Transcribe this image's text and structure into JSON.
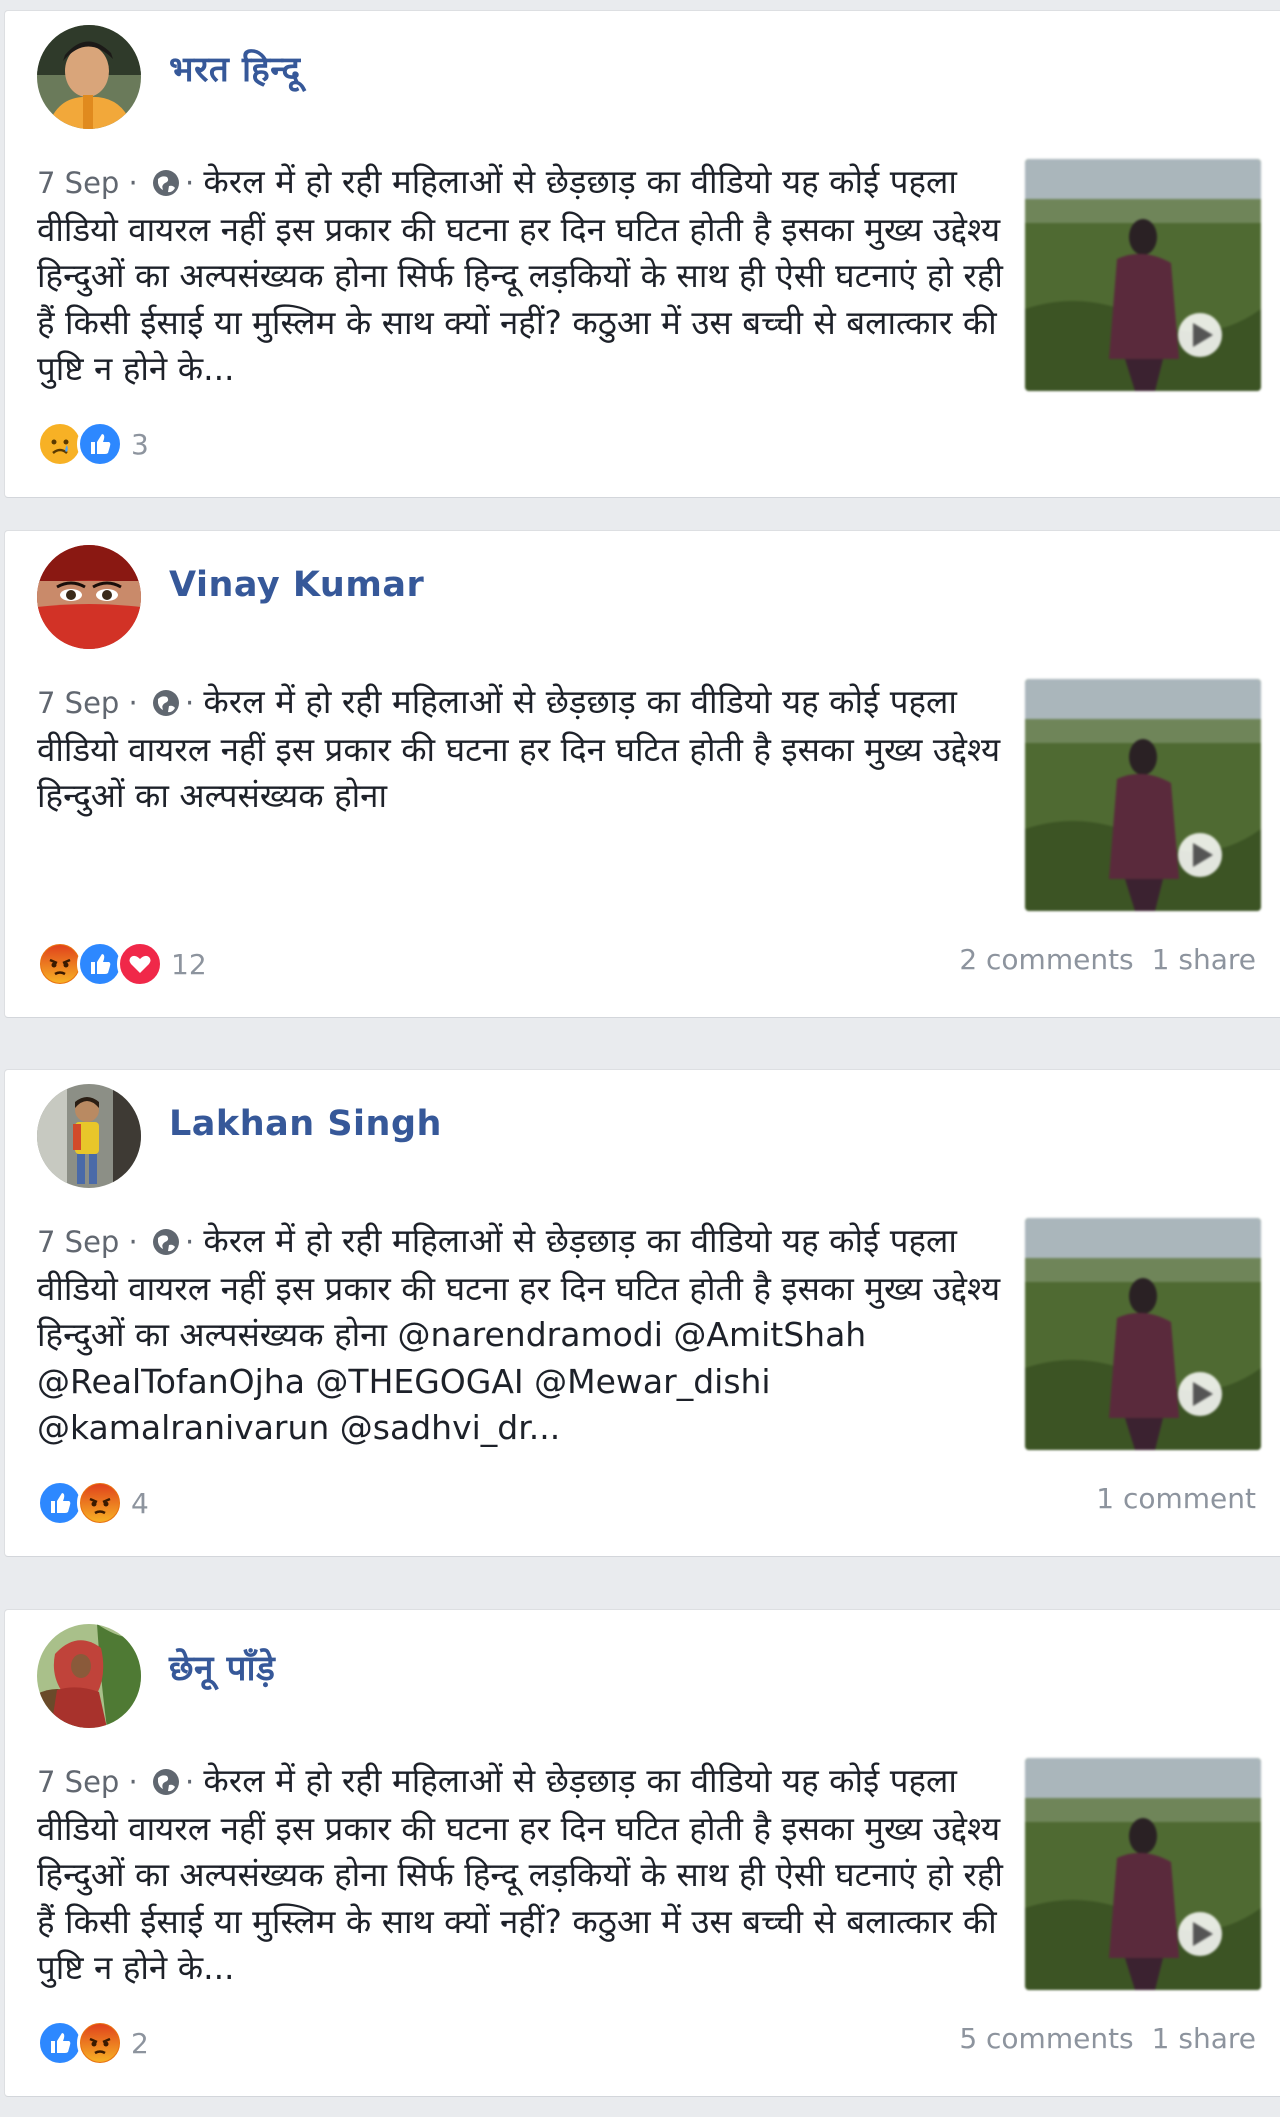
{
  "posts": [
    {
      "author": "भरत हिन्दू",
      "date": "7 Sep",
      "separator": " · ",
      "text": "केरल में हो रही महिलाओं से छेड़छाड़ का वीडियो यह कोई पहला वीडियो वायरल नहीं इस प्रकार की घटना हर दिन घटित होती है इसका मुख्य उद्देश्य हिन्दुओं का अल्पसंख्यक होना सिर्फ हिन्दू लड़कियों के साथ ही ऐसी घटनाएं हो रही हैं किसी ईसाई या मुस्लिम के साथ क्यों नहीं? कठुआ में उस बच्ची से बलात्कार की पुष्टि न होने के...",
      "reactions": [
        "sad",
        "like"
      ],
      "reaction_count": "3",
      "comments": "",
      "shares": ""
    },
    {
      "author": "Vinay Kumar",
      "date": "7 Sep",
      "separator": " · ",
      "text": "केरल में हो रही महिलाओं से छेड़छाड़ का वीडियो यह कोई पहला वीडियो वायरल नहीं इस प्रकार की घटना हर दिन घटित होती है इसका मुख्य उद्देश्य हिन्दुओं का अल्पसंख्यक होना",
      "reactions": [
        "angry",
        "like",
        "love"
      ],
      "reaction_count": "12",
      "comments": "2 comments",
      "shares": "1 share"
    },
    {
      "author": "Lakhan Singh",
      "date": "7 Sep",
      "separator": " · ",
      "text": "केरल में हो रही महिलाओं से छेड़छाड़ का वीडियो यह कोई पहला वीडियो वायरल नहीं इस प्रकार की घटना हर दिन घटित होती है इसका मुख्य उद्देश्य हिन्दुओं का अल्पसंख्यक होना @narendramodi @AmitShah @RealTofanOjha @THEGOGAI @Mewar_dishi @kamalranivarun @sadhvi_dr...",
      "reactions": [
        "like",
        "angry"
      ],
      "reaction_count": "4",
      "comments": "1 comment",
      "shares": ""
    },
    {
      "author": "छेनू पाँड़े",
      "date": "7 Sep",
      "separator": " · ",
      "text": "केरल में हो रही महिलाओं से छेड़छाड़ का वीडियो यह कोई पहला वीडियो वायरल नहीं इस प्रकार की घटना हर दिन घटित होती है इसका मुख्य उद्देश्य हिन्दुओं का अल्पसंख्यक होना सिर्फ हिन्दू लड़कियों के साथ ही ऐसी घटनाएं हो रही हैं किसी ईसाई या मुस्लिम के साथ क्यों नहीं? कठुआ में उस बच्ची से बलात्कार की पुष्टि न होने के...",
      "reactions": [
        "like",
        "angry"
      ],
      "reaction_count": "2",
      "comments": "5 comments",
      "shares": "1 share"
    }
  ],
  "colors": {
    "like": "#2d88ff",
    "love": "#f02849",
    "sad": "#f7b125",
    "angry": "#e9710f",
    "author": "#365899"
  }
}
